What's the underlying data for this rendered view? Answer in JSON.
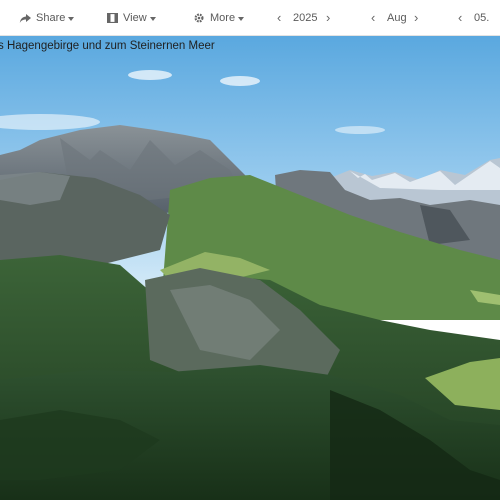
{
  "toolbar": {
    "share_label": "Share",
    "view_label": "View",
    "more_label": "More",
    "year": "2025",
    "month": "Aug",
    "day": "05."
  },
  "photo": {
    "caption": "s Hagengebirge und zum Steinernen Meer"
  },
  "icons": [
    "share-icon",
    "view-icon",
    "gear-icon",
    "chevron-left-icon",
    "chevron-right-icon",
    "caret-down-icon"
  ],
  "colors": {
    "toolbar_bg": "#ffffff",
    "toolbar_text": "#5a5a5a",
    "sky": "#7fbfe8"
  }
}
